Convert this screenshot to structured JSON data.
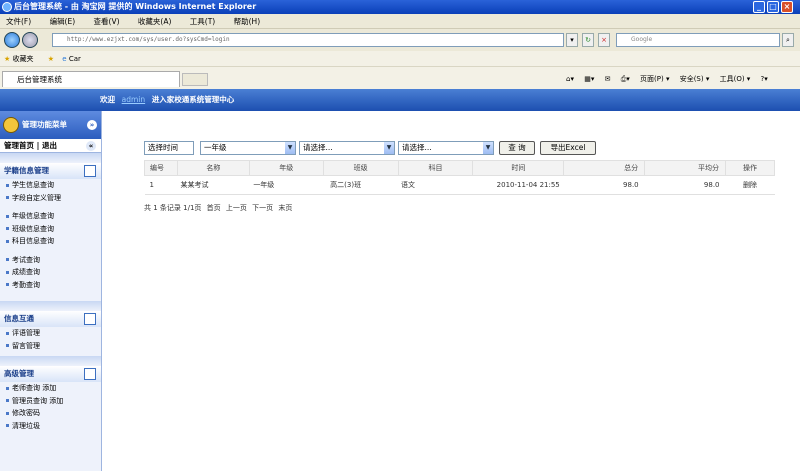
{
  "window": {
    "title": "后台管理系统 - 由 淘宝网 提供的 Windows Internet Explorer"
  },
  "menu": [
    "文件(F)",
    "编辑(E)",
    "查看(V)",
    "收藏夹(A)",
    "工具(T)",
    "帮助(H)"
  ],
  "address": {
    "url": "http://www.ezjxt.com/sys/user.do?sysCmd=login",
    "search_placeholder": "Google"
  },
  "favorites": {
    "label": "收藏夹",
    "item": "Car"
  },
  "tab": {
    "label": "后台管理系统"
  },
  "ie_tools": {
    "page": "页面(P) ▾",
    "safety": "安全(S) ▾",
    "tools": "工具(O) ▾",
    "help": "?▾"
  },
  "header": {
    "welcome": "欢迎",
    "user": "admin",
    "text": "进入家校通系统管理中心"
  },
  "sidebar": {
    "title": "管理功能菜单",
    "home": "管理首页",
    "sep": "|",
    "logout": "退出",
    "groups": [
      {
        "title": "学籍信息管理",
        "items": [
          "学生信息查询",
          "字段自定义管理",
          "",
          "年级信息查询",
          "班级信息查询",
          "科目信息查询",
          "",
          "考试查询",
          "成绩查询",
          "考勤查询"
        ]
      },
      {
        "title": "信息互通",
        "items": [
          "评语管理",
          "留言管理"
        ]
      },
      {
        "title": "高级管理",
        "items": [
          "老师查询 添加",
          "管理员查询 添加",
          "修改密码",
          "清理垃圾"
        ]
      }
    ]
  },
  "filters": {
    "time_value": "选择时间",
    "grade_value": "一年级",
    "class_value": "请选择...",
    "subject_value": "请选择...",
    "query_label": "查 询",
    "export_label": "导出Excel"
  },
  "table": {
    "headers": [
      "编号",
      "名称",
      "年级",
      "班级",
      "科目",
      "时间",
      "总分",
      "平均分",
      "操作"
    ],
    "rows": [
      [
        "1",
        "某某考试",
        "一年级",
        "高二(3)班",
        "语文",
        "2010-11-04 21:55",
        "98.0",
        "98.0",
        "删除"
      ]
    ]
  },
  "pager": {
    "total": "共 1 条记录 1/1页",
    "first": "首页",
    "prev": "上一页",
    "next": "下一页",
    "last": "末页"
  },
  "colors": {
    "header_blue": "#1d4fb0",
    "sidebar_bg": "#eef2fb"
  }
}
